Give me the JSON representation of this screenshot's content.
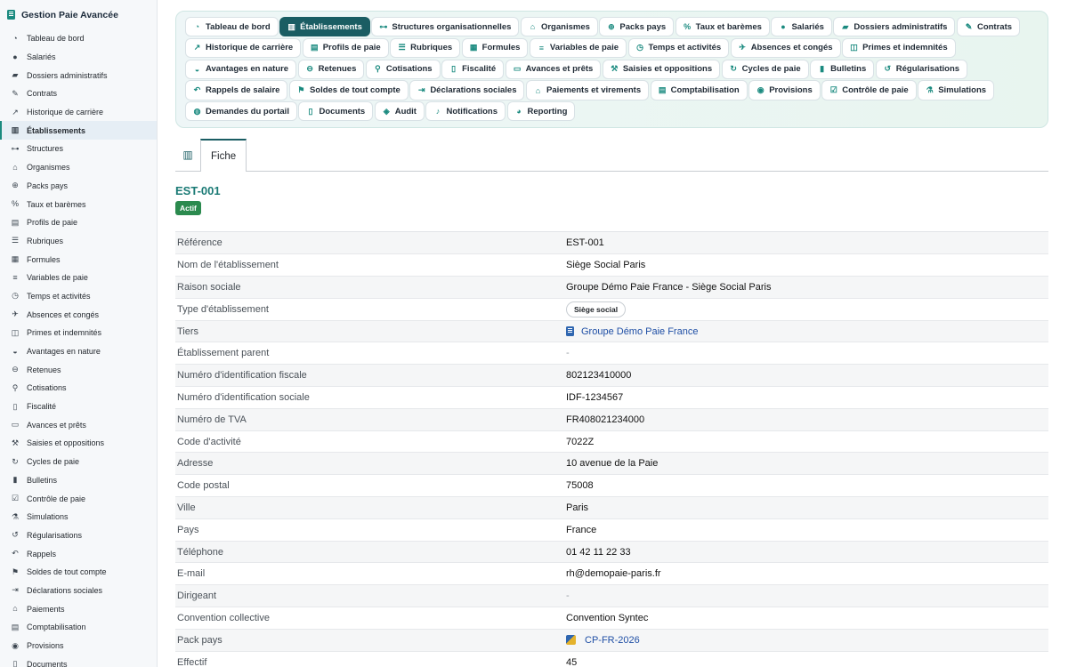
{
  "app": {
    "title": "Gestion Paie Avancée"
  },
  "sidebar": {
    "items": [
      {
        "label": "Tableau de bord",
        "icon": "dashboard-icon",
        "glyph": "◔",
        "active": false
      },
      {
        "label": "Salariés",
        "icon": "users-icon",
        "glyph": "●",
        "active": false
      },
      {
        "label": "Dossiers administratifs",
        "icon": "folder-icon",
        "glyph": "▰",
        "active": false
      },
      {
        "label": "Contrats",
        "icon": "contract-icon",
        "glyph": "✎",
        "active": false
      },
      {
        "label": "Historique de carrière",
        "icon": "chart-line-icon",
        "glyph": "↗",
        "active": false
      },
      {
        "label": "Établissements",
        "icon": "building-icon",
        "glyph": "▥",
        "active": true
      },
      {
        "label": "Structures",
        "icon": "org-chart-icon",
        "glyph": "⊶",
        "active": false
      },
      {
        "label": "Organismes",
        "icon": "institution-icon",
        "glyph": "⌂",
        "active": false
      },
      {
        "label": "Packs pays",
        "icon": "globe-icon",
        "glyph": "⊕",
        "active": false
      },
      {
        "label": "Taux et barèmes",
        "icon": "percent-icon",
        "glyph": "%",
        "active": false
      },
      {
        "label": "Profils de paie",
        "icon": "id-card-icon",
        "glyph": "▤",
        "active": false
      },
      {
        "label": "Rubriques",
        "icon": "list-icon",
        "glyph": "☰",
        "active": false
      },
      {
        "label": "Formules",
        "icon": "calculator-icon",
        "glyph": "▦",
        "active": false
      },
      {
        "label": "Variables de paie",
        "icon": "sliders-icon",
        "glyph": "≡",
        "active": false
      },
      {
        "label": "Temps et activités",
        "icon": "clock-icon",
        "glyph": "◷",
        "active": false
      },
      {
        "label": "Absences et congés",
        "icon": "plane-icon",
        "glyph": "✈",
        "active": false
      },
      {
        "label": "Primes et indemnités",
        "icon": "gift-icon",
        "glyph": "◫",
        "active": false
      },
      {
        "label": "Avantages en nature",
        "icon": "car-icon",
        "glyph": "◒",
        "active": false
      },
      {
        "label": "Retenues",
        "icon": "minus-circle-icon",
        "glyph": "⊖",
        "active": false
      },
      {
        "label": "Cotisations",
        "icon": "hand-coins-icon",
        "glyph": "⚲",
        "active": false
      },
      {
        "label": "Fiscalité",
        "icon": "file-tax-icon",
        "glyph": "▯",
        "active": false
      },
      {
        "label": "Avances et prêts",
        "icon": "money-icon",
        "glyph": "▭",
        "active": false
      },
      {
        "label": "Saisies et oppositions",
        "icon": "gavel-icon",
        "glyph": "⚒",
        "active": false
      },
      {
        "label": "Cycles de paie",
        "icon": "sync-icon",
        "glyph": "↻",
        "active": false
      },
      {
        "label": "Bulletins",
        "icon": "receipt-icon",
        "glyph": "▮",
        "active": false
      },
      {
        "label": "Contrôle de paie",
        "icon": "clipboard-check-icon",
        "glyph": "☑",
        "active": false
      },
      {
        "label": "Simulations",
        "icon": "flask-icon",
        "glyph": "⚗",
        "active": false
      },
      {
        "label": "Régularisations",
        "icon": "undo-icon",
        "glyph": "↺",
        "active": false
      },
      {
        "label": "Rappels",
        "icon": "history-icon",
        "glyph": "↶",
        "active": false
      },
      {
        "label": "Soldes de tout compte",
        "icon": "flag-icon",
        "glyph": "⚑",
        "active": false
      },
      {
        "label": "Déclarations sociales",
        "icon": "file-export-icon",
        "glyph": "⇥",
        "active": false
      },
      {
        "label": "Paiements",
        "icon": "bank-icon",
        "glyph": "⌂",
        "active": false
      },
      {
        "label": "Comptabilisation",
        "icon": "book-icon",
        "glyph": "▤",
        "active": false
      },
      {
        "label": "Provisions",
        "icon": "piggy-bank-icon",
        "glyph": "◉",
        "active": false
      },
      {
        "label": "Documents",
        "icon": "document-icon",
        "glyph": "▯",
        "active": false
      }
    ]
  },
  "tabs": [
    {
      "label": "Tableau de bord",
      "icon": "dashboard-icon",
      "glyph": "◔",
      "active": false
    },
    {
      "label": "Établissements",
      "icon": "building-icon",
      "glyph": "▥",
      "active": true
    },
    {
      "label": "Structures organisationnelles",
      "icon": "org-chart-icon",
      "glyph": "⊶",
      "active": false
    },
    {
      "label": "Organismes",
      "icon": "institution-icon",
      "glyph": "⌂",
      "active": false
    },
    {
      "label": "Packs pays",
      "icon": "globe-icon",
      "glyph": "⊕",
      "active": false
    },
    {
      "label": "Taux et barèmes",
      "icon": "percent-icon",
      "glyph": "%",
      "active": false
    },
    {
      "label": "Salariés",
      "icon": "user-icon",
      "glyph": "●",
      "active": false
    },
    {
      "label": "Dossiers administratifs",
      "icon": "folder-icon",
      "glyph": "▰",
      "active": false
    },
    {
      "label": "Contrats",
      "icon": "contract-icon",
      "glyph": "✎",
      "active": false
    },
    {
      "label": "Historique de carrière",
      "icon": "chart-line-icon",
      "glyph": "↗",
      "active": false
    },
    {
      "label": "Profils de paie",
      "icon": "id-card-icon",
      "glyph": "▤",
      "active": false
    },
    {
      "label": "Rubriques",
      "icon": "list-icon",
      "glyph": "☰",
      "active": false
    },
    {
      "label": "Formules",
      "icon": "calculator-icon",
      "glyph": "▦",
      "active": false
    },
    {
      "label": "Variables de paie",
      "icon": "sliders-icon",
      "glyph": "≡",
      "active": false
    },
    {
      "label": "Temps et activités",
      "icon": "clock-icon",
      "glyph": "◷",
      "active": false
    },
    {
      "label": "Absences et congés",
      "icon": "plane-icon",
      "glyph": "✈",
      "active": false
    },
    {
      "label": "Primes et indemnités",
      "icon": "gift-icon",
      "glyph": "◫",
      "active": false
    },
    {
      "label": "Avantages en nature",
      "icon": "car-icon",
      "glyph": "◒",
      "active": false
    },
    {
      "label": "Retenues",
      "icon": "minus-circle-icon",
      "glyph": "⊖",
      "active": false
    },
    {
      "label": "Cotisations",
      "icon": "hand-coins-icon",
      "glyph": "⚲",
      "active": false
    },
    {
      "label": "Fiscalité",
      "icon": "file-tax-icon",
      "glyph": "▯",
      "active": false
    },
    {
      "label": "Avances et prêts",
      "icon": "money-icon",
      "glyph": "▭",
      "active": false
    },
    {
      "label": "Saisies et oppositions",
      "icon": "gavel-icon",
      "glyph": "⚒",
      "active": false
    },
    {
      "label": "Cycles de paie",
      "icon": "sync-icon",
      "glyph": "↻",
      "active": false
    },
    {
      "label": "Bulletins",
      "icon": "receipt-icon",
      "glyph": "▮",
      "active": false
    },
    {
      "label": "Régularisations",
      "icon": "undo-icon",
      "glyph": "↺",
      "active": false
    },
    {
      "label": "Rappels de salaire",
      "icon": "history-icon",
      "glyph": "↶",
      "active": false
    },
    {
      "label": "Soldes de tout compte",
      "icon": "flag-icon",
      "glyph": "⚑",
      "active": false
    },
    {
      "label": "Déclarations sociales",
      "icon": "file-export-icon",
      "glyph": "⇥",
      "active": false
    },
    {
      "label": "Paiements et virements",
      "icon": "bank-icon",
      "glyph": "⌂",
      "active": false
    },
    {
      "label": "Comptabilisation",
      "icon": "book-icon",
      "glyph": "▤",
      "active": false
    },
    {
      "label": "Provisions",
      "icon": "piggy-bank-icon",
      "glyph": "◉",
      "active": false
    },
    {
      "label": "Contrôle de paie",
      "icon": "clipboard-check-icon",
      "glyph": "☑",
      "active": false
    },
    {
      "label": "Simulations",
      "icon": "flask-icon",
      "glyph": "⚗",
      "active": false
    },
    {
      "label": "Demandes du portail",
      "icon": "comment-icon",
      "glyph": "◍",
      "active": false
    },
    {
      "label": "Documents",
      "icon": "document-icon",
      "glyph": "▯",
      "active": false
    },
    {
      "label": "Audit",
      "icon": "shield-icon",
      "glyph": "◈",
      "active": false
    },
    {
      "label": "Notifications",
      "icon": "bell-icon",
      "glyph": "♪",
      "active": false
    },
    {
      "label": "Reporting",
      "icon": "pie-chart-icon",
      "glyph": "◕",
      "active": false
    }
  ],
  "record_tabs": [
    {
      "label": "Fiche",
      "active": true
    }
  ],
  "record": {
    "title": "EST-001",
    "status": "Actif",
    "fields": [
      {
        "label": "Référence",
        "value": "EST-001",
        "kind": "text"
      },
      {
        "label": "Nom de l'établissement",
        "value": "Siège Social Paris",
        "kind": "text"
      },
      {
        "label": "Raison sociale",
        "value": "Groupe Démo Paie France - Siège Social Paris",
        "kind": "text"
      },
      {
        "label": "Type d'établissement",
        "value": "Siège social",
        "kind": "chip"
      },
      {
        "label": "Tiers",
        "value": "Groupe Démo Paie France",
        "kind": "link",
        "icon": "building-icon"
      },
      {
        "label": "Établissement parent",
        "value": "-",
        "kind": "empty"
      },
      {
        "label": "Numéro d'identification fiscale",
        "value": "802123410000",
        "kind": "text"
      },
      {
        "label": "Numéro d'identification sociale",
        "value": "IDF-1234567",
        "kind": "text"
      },
      {
        "label": "Numéro de TVA",
        "value": "FR408021234000",
        "kind": "text"
      },
      {
        "label": "Code d'activité",
        "value": "7022Z",
        "kind": "text"
      },
      {
        "label": "Adresse",
        "value": "10 avenue de la Paie",
        "kind": "text"
      },
      {
        "label": "Code postal",
        "value": "75008",
        "kind": "text"
      },
      {
        "label": "Ville",
        "value": "Paris",
        "kind": "text"
      },
      {
        "label": "Pays",
        "value": "France",
        "kind": "text"
      },
      {
        "label": "Téléphone",
        "value": "01 42 11 22 33",
        "kind": "text"
      },
      {
        "label": "E-mail",
        "value": "rh@demopaie-paris.fr",
        "kind": "text"
      },
      {
        "label": "Dirigeant",
        "value": "-",
        "kind": "empty"
      },
      {
        "label": "Convention collective",
        "value": "Convention Syntec",
        "kind": "text"
      },
      {
        "label": "Pack pays",
        "value": "CP-FR-2026",
        "kind": "link",
        "icon": "country-pack-icon"
      },
      {
        "label": "Effectif",
        "value": "45",
        "kind": "text"
      }
    ]
  },
  "colors": {
    "accent": "#1a8a7f",
    "active_tab": "#1a5d63",
    "title": "#1a7a75",
    "status_badge": "#2b8a4e",
    "link": "#1f4fa5"
  }
}
